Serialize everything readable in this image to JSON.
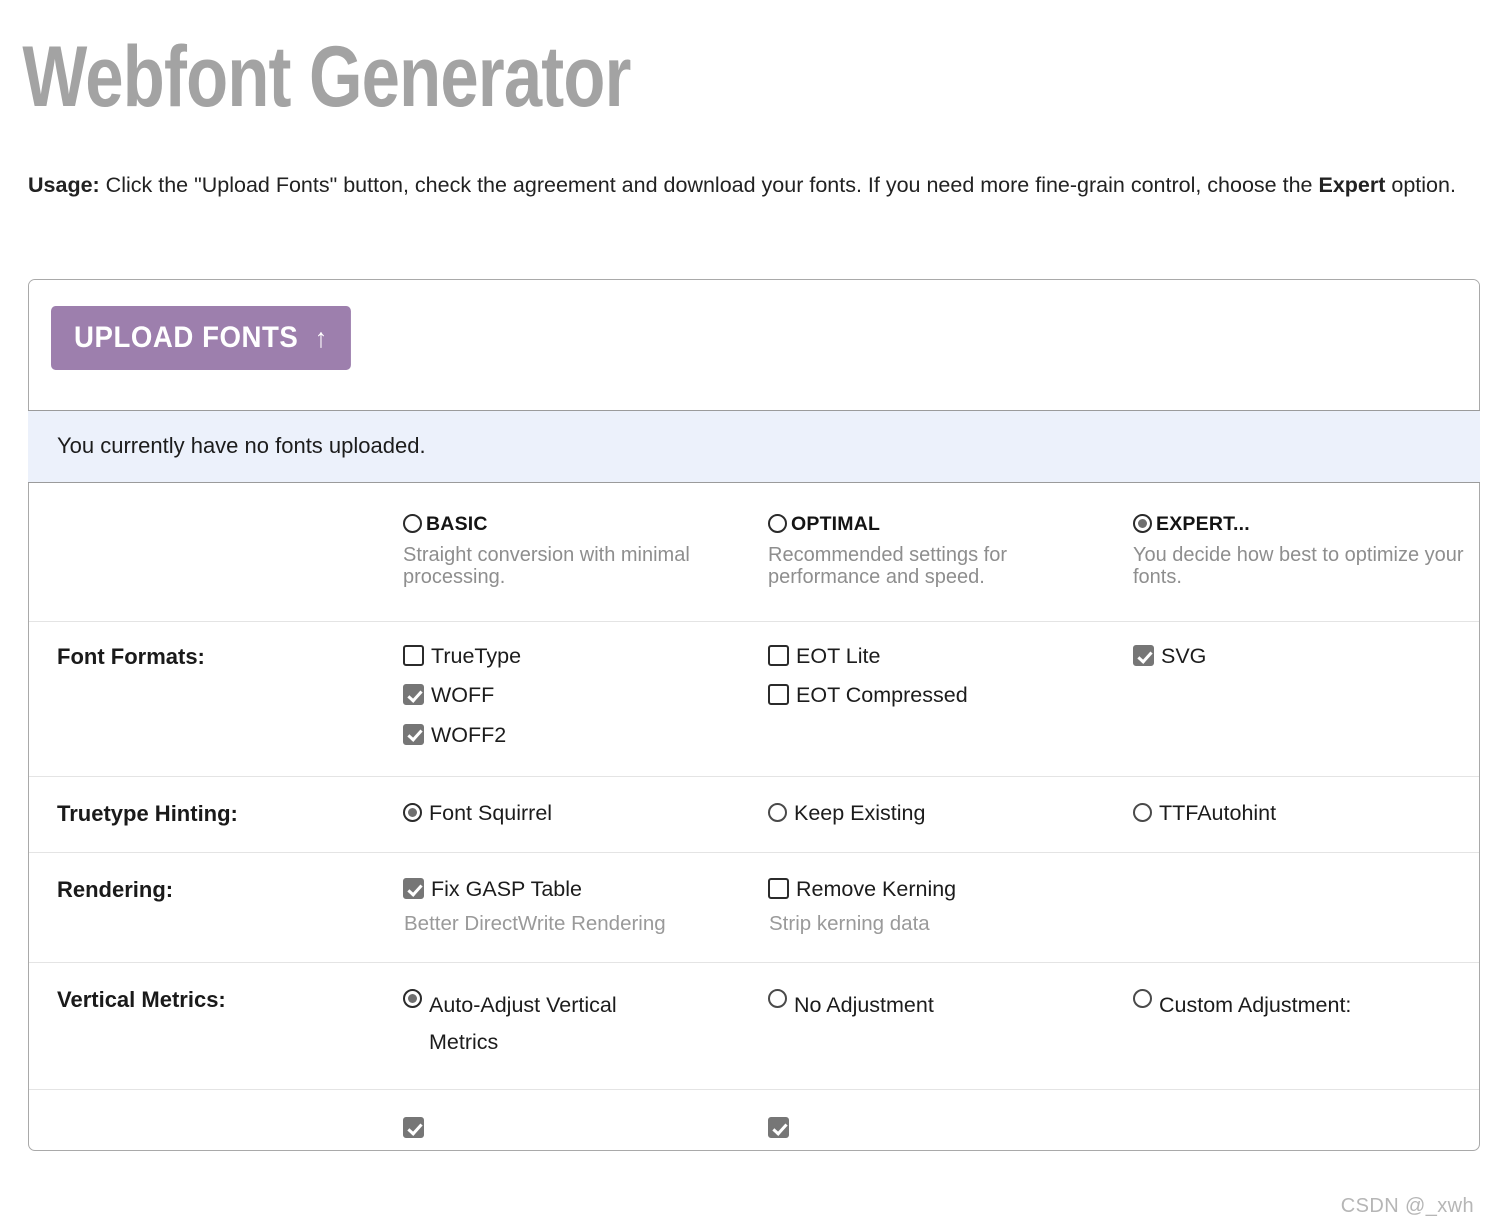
{
  "page": {
    "title": "Webfont Generator",
    "watermark": "CSDN @_xwh"
  },
  "usage": {
    "label": "Usage:",
    "text_part1": " Click the \"Upload Fonts\" button, check the agreement and download your fonts. If you need more fine-grain control, choose the ",
    "emphasis": "Expert",
    "text_part2": " option."
  },
  "panel": {
    "upload_button": {
      "label": "UPLOAD FONTS",
      "icon": "arrow-up-icon",
      "icon_glyph": "↑",
      "color": "#9d7fad"
    },
    "notice": "You currently have no fonts uploaded.",
    "modes": [
      {
        "id": "basic",
        "label": "BASIC",
        "description": "Straight conversion with minimal processing.",
        "selected": false
      },
      {
        "id": "optimal",
        "label": "OPTIMAL",
        "description": "Recommended settings for performance and speed.",
        "selected": false
      },
      {
        "id": "expert",
        "label": "EXPERT...",
        "description": "You decide how best to optimize your fonts.",
        "selected": true
      }
    ],
    "rows": [
      {
        "id": "font-formats",
        "label": "Font Formats:",
        "columns": [
          {
            "items": [
              {
                "type": "checkbox",
                "label": "TrueType",
                "checked": false
              },
              {
                "type": "checkbox",
                "label": "WOFF",
                "checked": true
              },
              {
                "type": "checkbox",
                "label": "WOFF2",
                "checked": true
              }
            ]
          },
          {
            "items": [
              {
                "type": "checkbox",
                "label": "EOT Lite",
                "checked": false
              },
              {
                "type": "checkbox",
                "label": "EOT Compressed",
                "checked": false
              }
            ]
          },
          {
            "items": [
              {
                "type": "checkbox",
                "label": "SVG",
                "checked": true
              }
            ]
          }
        ]
      },
      {
        "id": "truetype-hinting",
        "label": "Truetype Hinting:",
        "columns": [
          {
            "items": [
              {
                "type": "radio",
                "label": "Font Squirrel",
                "checked": true
              }
            ]
          },
          {
            "items": [
              {
                "type": "radio",
                "label": "Keep Existing",
                "checked": false
              }
            ]
          },
          {
            "items": [
              {
                "type": "radio",
                "label": "TTFAutohint",
                "checked": false
              }
            ]
          }
        ]
      },
      {
        "id": "rendering",
        "label": "Rendering:",
        "columns": [
          {
            "items": [
              {
                "type": "checkbox",
                "label": "Fix GASP Table",
                "checked": true,
                "note": "Better DirectWrite Rendering"
              }
            ]
          },
          {
            "items": [
              {
                "type": "checkbox",
                "label": "Remove Kerning",
                "checked": false,
                "note": "Strip kerning data"
              }
            ]
          },
          {
            "items": []
          }
        ]
      },
      {
        "id": "vertical-metrics",
        "label": "Vertical Metrics:",
        "columns": [
          {
            "items": [
              {
                "type": "radio",
                "label": "Auto-Adjust Vertical Metrics",
                "checked": true
              }
            ]
          },
          {
            "items": [
              {
                "type": "radio",
                "label": "No Adjustment",
                "checked": false
              }
            ]
          },
          {
            "items": [
              {
                "type": "radio",
                "label": "Custom Adjustment:",
                "checked": false
              }
            ]
          }
        ]
      }
    ],
    "clipped_row": {
      "columns": [
        {
          "items": [
            {
              "type": "checkbox",
              "label": "",
              "checked": true
            }
          ]
        },
        {
          "items": [
            {
              "type": "checkbox",
              "label": "",
              "checked": true
            }
          ]
        },
        {
          "items": []
        }
      ]
    }
  }
}
